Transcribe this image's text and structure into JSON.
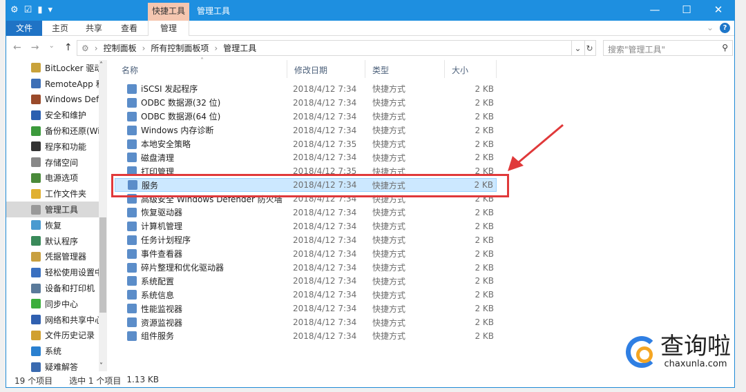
{
  "titlebar": {
    "context_tab": "快捷工具",
    "title": "管理工具",
    "minimize": "—",
    "maximize": "☐",
    "close": "✕"
  },
  "ribbon": {
    "tabs": [
      "文件",
      "主页",
      "共享",
      "查看",
      "管理"
    ],
    "help": "?"
  },
  "address": {
    "crumbs": [
      "控制面板",
      "所有控制面板项",
      "管理工具"
    ],
    "search_placeholder": "搜索\"管理工具\""
  },
  "sidebar": {
    "items": [
      "BitLocker 驱动",
      "RemoteApp 和",
      "Windows Def",
      "安全和维护",
      "备份和还原(Wi",
      "程序和功能",
      "存储空间",
      "电源选项",
      "工作文件夹",
      "管理工具",
      "恢复",
      "默认程序",
      "凭据管理器",
      "轻松使用设置中",
      "设备和打印机",
      "同步中心",
      "网络和共享中心",
      "文件历史记录",
      "系统",
      "疑难解答"
    ],
    "selected": "管理工具"
  },
  "columns": [
    "名称",
    "修改日期",
    "类型",
    "大小"
  ],
  "files": [
    {
      "name": "iSCSI 发起程序",
      "date": "2018/4/12 7:34",
      "type": "快捷方式",
      "size": "2 KB"
    },
    {
      "name": "ODBC 数据源(32 位)",
      "date": "2018/4/12 7:34",
      "type": "快捷方式",
      "size": "2 KB"
    },
    {
      "name": "ODBC 数据源(64 位)",
      "date": "2018/4/12 7:34",
      "type": "快捷方式",
      "size": "2 KB"
    },
    {
      "name": "Windows 内存诊断",
      "date": "2018/4/12 7:34",
      "type": "快捷方式",
      "size": "2 KB"
    },
    {
      "name": "本地安全策略",
      "date": "2018/4/12 7:35",
      "type": "快捷方式",
      "size": "2 KB"
    },
    {
      "name": "磁盘清理",
      "date": "2018/4/12 7:34",
      "type": "快捷方式",
      "size": "2 KB"
    },
    {
      "name": "打印管理",
      "date": "2018/4/12 7:35",
      "type": "快捷方式",
      "size": "2 KB"
    },
    {
      "name": "服务",
      "date": "2018/4/12 7:34",
      "type": "快捷方式",
      "size": "2 KB"
    },
    {
      "name": "高级安全 Windows Defender 防火墙",
      "date": "2018/4/12 7:34",
      "type": "快捷方式",
      "size": "2 KB"
    },
    {
      "name": "恢复驱动器",
      "date": "2018/4/12 7:34",
      "type": "快捷方式",
      "size": "2 KB"
    },
    {
      "name": "计算机管理",
      "date": "2018/4/12 7:34",
      "type": "快捷方式",
      "size": "2 KB"
    },
    {
      "name": "任务计划程序",
      "date": "2018/4/12 7:34",
      "type": "快捷方式",
      "size": "2 KB"
    },
    {
      "name": "事件查看器",
      "date": "2018/4/12 7:34",
      "type": "快捷方式",
      "size": "2 KB"
    },
    {
      "name": "碎片整理和优化驱动器",
      "date": "2018/4/12 7:34",
      "type": "快捷方式",
      "size": "2 KB"
    },
    {
      "name": "系统配置",
      "date": "2018/4/12 7:34",
      "type": "快捷方式",
      "size": "2 KB"
    },
    {
      "name": "系统信息",
      "date": "2018/4/12 7:34",
      "type": "快捷方式",
      "size": "2 KB"
    },
    {
      "name": "性能监视器",
      "date": "2018/4/12 7:34",
      "type": "快捷方式",
      "size": "2 KB"
    },
    {
      "name": "资源监视器",
      "date": "2018/4/12 7:34",
      "type": "快捷方式",
      "size": "2 KB"
    },
    {
      "name": "组件服务",
      "date": "2018/4/12 7:34",
      "type": "快捷方式",
      "size": "2 KB"
    }
  ],
  "selected_file": "服务",
  "status": {
    "count": "19 个项目",
    "selected": "选中 1 个项目",
    "size": "1.13 KB"
  },
  "watermark": {
    "text": "查询啦",
    "url": "chaxunla.com"
  },
  "colors": {
    "titlebar": "#1e8fe0",
    "selection": "#cce8ff",
    "highlight": "#e0393a"
  }
}
